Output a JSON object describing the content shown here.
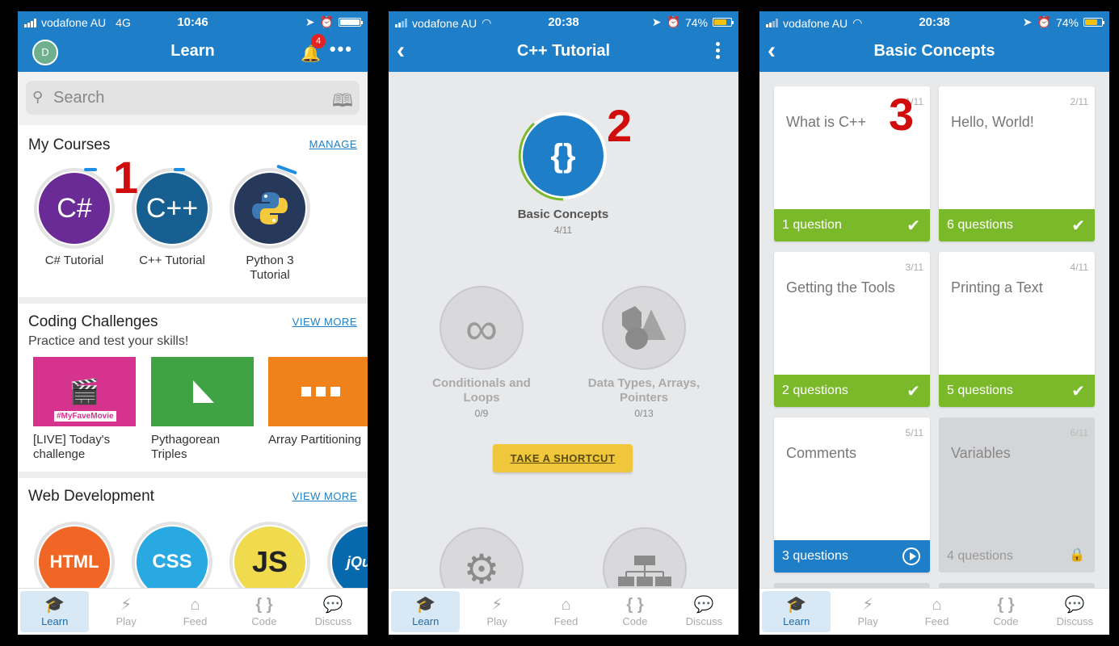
{
  "phone1": {
    "status": {
      "carrier": "vodafone AU",
      "network": "4G",
      "time": "10:46"
    },
    "header": {
      "title": "Learn",
      "avatar_initial": "D",
      "notification_count": "4"
    },
    "search": {
      "placeholder": "Search"
    },
    "my_courses": {
      "title": "My Courses",
      "link": "MANAGE",
      "courses": [
        {
          "label": "C# Tutorial",
          "glyph": "C#",
          "color": "#6a2b96"
        },
        {
          "label": "C++ Tutorial",
          "glyph": "C++",
          "color": "#185f91"
        },
        {
          "label": "Python 3 Tutorial",
          "glyph": "",
          "color": "#27395a"
        }
      ]
    },
    "challenges": {
      "title": "Coding Challenges",
      "subtitle": "Practice and test your skills!",
      "link": "VIEW MORE",
      "items": [
        {
          "label": "[LIVE] Today's challenge",
          "tag": "#MyFaveMovie",
          "color": "#d6338f"
        },
        {
          "label": "Pythagorean Triples",
          "color": "#3fa243"
        },
        {
          "label": "Array Partitioning",
          "color": "#f0821b"
        }
      ]
    },
    "web": {
      "title": "Web Development",
      "link": "VIEW MORE",
      "items": [
        {
          "label": "HTML",
          "color": "#f26625"
        },
        {
          "label": "CSS",
          "color": "#29a9e1"
        },
        {
          "label": "JS",
          "color": "#f0db4f"
        },
        {
          "label": "jQu",
          "color": "#0769ad"
        }
      ]
    },
    "marker": "1"
  },
  "phone2": {
    "status": {
      "carrier": "vodafone AU",
      "time": "20:38",
      "battery": "74%"
    },
    "header": {
      "title": "C++ Tutorial"
    },
    "lessons": [
      {
        "name": "Basic Concepts",
        "count": "4/11",
        "glyph": "{}"
      },
      {
        "name": "Conditionals and Loops",
        "count": "0/9",
        "glyph": "∞"
      },
      {
        "name": "Data Types, Arrays, Pointers",
        "count": "0/13",
        "glyph": ""
      }
    ],
    "shortcut": "TAKE A SHORTCUT",
    "marker": "2"
  },
  "phone3": {
    "status": {
      "carrier": "vodafone AU",
      "time": "20:38",
      "battery": "74%"
    },
    "header": {
      "title": "Basic Concepts"
    },
    "cards": [
      {
        "title": "What is C++",
        "num": "1/11",
        "questions": "1 question",
        "state": "done"
      },
      {
        "title": "Hello, World!",
        "num": "2/11",
        "questions": "6 questions",
        "state": "done"
      },
      {
        "title": "Getting the Tools",
        "num": "3/11",
        "questions": "2 questions",
        "state": "done"
      },
      {
        "title": "Printing a Text",
        "num": "4/11",
        "questions": "5 questions",
        "state": "done"
      },
      {
        "title": "Comments",
        "num": "5/11",
        "questions": "3 questions",
        "state": "current"
      },
      {
        "title": "Variables",
        "num": "6/11",
        "questions": "4 questions",
        "state": "locked"
      }
    ],
    "marker": "3"
  },
  "nav": [
    "Learn",
    "Play",
    "Feed",
    "Code",
    "Discuss"
  ],
  "colors": {
    "brand": "#1e7fc8",
    "done": "#7ab929",
    "current": "#1e7fc8",
    "locked": "#d4d5d7",
    "battery_low": "#f2c00f"
  }
}
